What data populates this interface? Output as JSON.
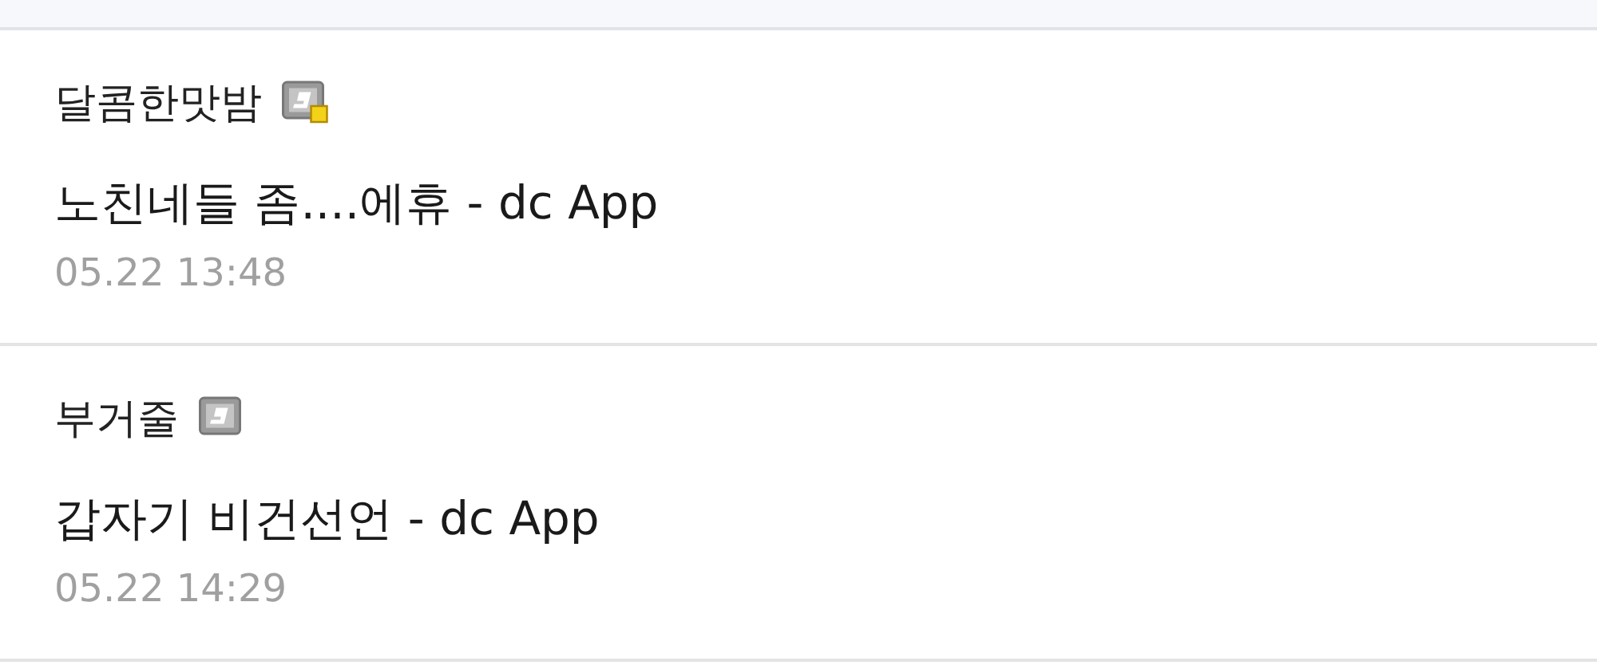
{
  "posts": [
    {
      "author": "달콤한맛밤",
      "badge_corner_mark": true,
      "title": "노친네들 좀....에휴 - dc App",
      "time": "05.22 13:48"
    },
    {
      "author": "부거줄",
      "badge_corner_mark": false,
      "title": "갑자기 비건선언 - dc App",
      "time": "05.22 14:29"
    }
  ]
}
